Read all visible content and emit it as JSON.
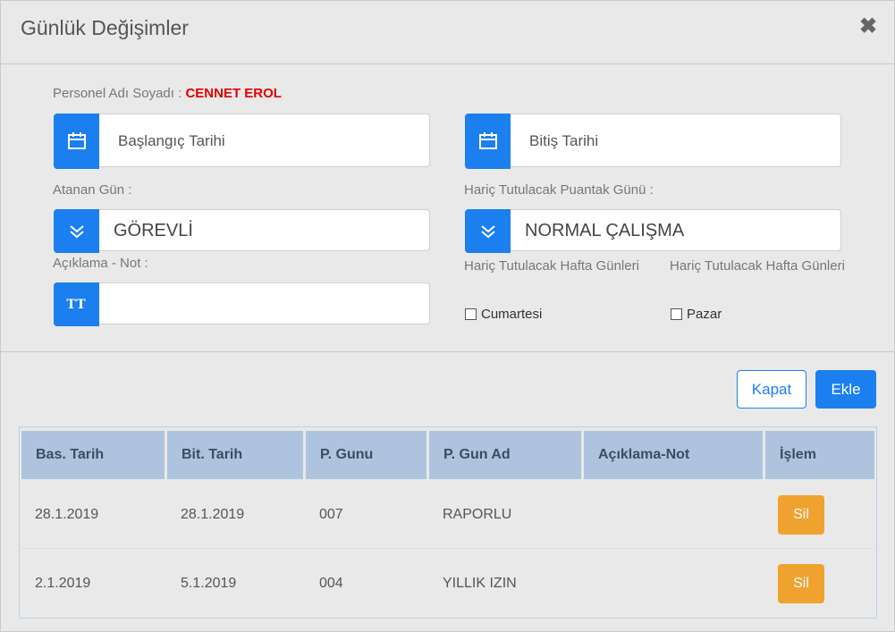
{
  "header": {
    "title": "Günlük Değişimler",
    "close_symbol": "✖"
  },
  "form": {
    "person_label": "Personel Adı Soyadı :",
    "person_name": "CENNET EROL",
    "start_date_placeholder": "Başlangıç Tarihi",
    "end_date_placeholder": "Bitiş Tarihi",
    "assigned_day_label": "Atanan Gün :",
    "assigned_day_value": "GÖREVLİ",
    "excluded_day_label": "Hariç Tutulacak Puantak Günü :",
    "excluded_day_value": "NORMAL ÇALIŞMA",
    "note_label": "Açıklama - Not :",
    "note_addon": "TT",
    "note_value": "",
    "week_days_label_1": "Hariç Tutulacak Hafta Günleri",
    "week_days_label_2": "Hariç Tutulacak Hafta Günleri",
    "saturday_label": "Cumartesi",
    "sunday_label": "Pazar",
    "saturday_checked": false,
    "sunday_checked": false
  },
  "actions": {
    "close_label": "Kapat",
    "add_label": "Ekle"
  },
  "table": {
    "columns": [
      "Bas. Tarih",
      "Bit. Tarih",
      "P. Gunu",
      "P. Gun Ad",
      "Açıklama-Not",
      "İşlem"
    ],
    "rows": [
      {
        "start": "28.1.2019",
        "end": "28.1.2019",
        "day": "007",
        "day_name": "RAPORLU",
        "note": "",
        "action": "Sil"
      },
      {
        "start": "2.1.2019",
        "end": "5.1.2019",
        "day": "004",
        "day_name": "YILLIK IZIN",
        "note": "",
        "action": "Sil"
      }
    ]
  },
  "colors": {
    "accent": "#1b7fef",
    "delete": "#efa32e",
    "name": "#e00000",
    "table_header": "#aec4de"
  }
}
